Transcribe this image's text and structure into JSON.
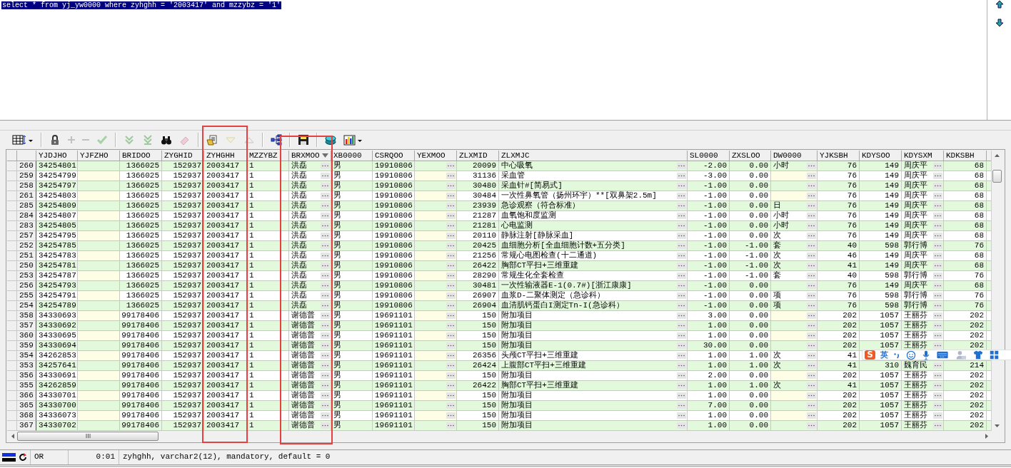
{
  "sql_editor": {
    "query": "select * from yj_yw0000 where zyhghh = '2003417' and mzzybz = '1'",
    "selected": true
  },
  "toolbar": [
    {
      "kind": "grid",
      "disabled": false
    },
    {
      "kind": "separator"
    },
    {
      "kind": "lock",
      "disabled": false
    },
    {
      "kind": "add",
      "disabled": true
    },
    {
      "kind": "remove",
      "disabled": true
    },
    {
      "kind": "confirm",
      "disabled": true
    },
    {
      "kind": "separator"
    },
    {
      "kind": "next",
      "disabled": true
    },
    {
      "kind": "last",
      "disabled": true
    },
    {
      "kind": "find",
      "disabled": false
    },
    {
      "kind": "clear",
      "disabled": true
    },
    {
      "kind": "separator"
    },
    {
      "kind": "query",
      "disabled": false
    },
    {
      "kind": "down",
      "disabled": true
    },
    {
      "kind": "up",
      "disabled": true
    },
    {
      "kind": "separator"
    },
    {
      "kind": "tree",
      "disabled": false
    },
    {
      "kind": "separator"
    },
    {
      "kind": "save",
      "disabled": false
    },
    {
      "kind": "separator"
    },
    {
      "kind": "database",
      "disabled": false
    },
    {
      "kind": "chart",
      "disabled": false
    }
  ],
  "table": {
    "columns": [
      {
        "kind": "rownum"
      },
      {
        "title": "YJDJHO",
        "kind": "text",
        "filter": false
      },
      {
        "title": "YJFZHO",
        "kind": "text",
        "filter": false
      },
      {
        "title": "BRIDOO",
        "kind": "number",
        "filter": false
      },
      {
        "title": "ZYGHID",
        "kind": "number",
        "filter": false
      },
      {
        "title": "ZYHGHH",
        "kind": "text",
        "filter": false
      },
      {
        "title": "MZZYBZ",
        "kind": "text",
        "filter": false
      },
      {
        "title": "BRXMOO",
        "kind": "lookup",
        "filter": true
      },
      {
        "title": "XB0000",
        "kind": "text",
        "filter": false
      },
      {
        "title": "CSRQOO",
        "kind": "text",
        "filter": false
      },
      {
        "title": "YEXMOO",
        "kind": "lookup",
        "filter": false
      },
      {
        "title": "ZLXMID",
        "kind": "number",
        "filter": false
      },
      {
        "title": "ZLXMJC",
        "kind": "lookup",
        "filter": false
      },
      {
        "title": "SL0000",
        "kind": "number",
        "filter": false
      },
      {
        "title": "ZXSLOO",
        "kind": "number",
        "filter": false
      },
      {
        "title": "DW0000",
        "kind": "lookup",
        "filter": false
      },
      {
        "title": "YJKSBH",
        "kind": "number",
        "filter": false
      },
      {
        "title": "KDYSOO",
        "kind": "number",
        "filter": false
      },
      {
        "title": "KDYSXM",
        "kind": "lookup",
        "filter": false
      },
      {
        "title": "KDKSBH",
        "kind": "number",
        "filter": false
      }
    ],
    "rows": [
      [
        "260",
        "34254801",
        null,
        "1366025",
        "152937",
        "2003417",
        "1",
        "洪磊",
        "男",
        "19910806",
        null,
        "20099",
        "中心吸氧",
        "-2.00",
        "0.00",
        "小时",
        "76",
        "149",
        "周庆平",
        "68"
      ],
      [
        "259",
        "34254799",
        null,
        "1366025",
        "152937",
        "2003417",
        "1",
        "洪磊",
        "男",
        "19910806",
        null,
        "31136",
        "采血管",
        "-3.00",
        "0.00",
        null,
        "76",
        "149",
        "周庆平",
        "68"
      ],
      [
        "258",
        "34254797",
        null,
        "1366025",
        "152937",
        "2003417",
        "1",
        "洪磊",
        "男",
        "19910806",
        null,
        "30480",
        "采血针#[简易式]",
        "-1.00",
        "0.00",
        null,
        "76",
        "149",
        "周庆平",
        "68"
      ],
      [
        "261",
        "34254803",
        null,
        "1366025",
        "152937",
        "2003417",
        "1",
        "洪磊",
        "男",
        "19910806",
        null,
        "30484",
        "一次性鼻氧管（扬州环宇）**[双鼻架2.5m]",
        "-1.00",
        "0.00",
        null,
        "76",
        "149",
        "周庆平",
        "68"
      ],
      [
        "285",
        "34254809",
        null,
        "1366025",
        "152937",
        "2003417",
        "1",
        "洪磊",
        "男",
        "19910806",
        null,
        "23939",
        "急诊观察（符合标准）",
        "-1.00",
        "0.00",
        "日",
        "76",
        "149",
        "周庆平",
        "68"
      ],
      [
        "284",
        "34254807",
        null,
        "1366025",
        "152937",
        "2003417",
        "1",
        "洪磊",
        "男",
        "19910806",
        null,
        "21287",
        "血氧饱和度监测",
        "-1.00",
        "0.00",
        "小时",
        "76",
        "149",
        "周庆平",
        "68"
      ],
      [
        "283",
        "34254805",
        null,
        "1366025",
        "152937",
        "2003417",
        "1",
        "洪磊",
        "男",
        "19910806",
        null,
        "21281",
        "心电监测",
        "-1.00",
        "0.00",
        "小时",
        "76",
        "149",
        "周庆平",
        "68"
      ],
      [
        "257",
        "34254795",
        null,
        "1366025",
        "152937",
        "2003417",
        "1",
        "洪磊",
        "男",
        "19910806",
        null,
        "20110",
        "静脉注射[静脉采血]",
        "-1.00",
        "0.00",
        "次",
        "76",
        "149",
        "周庆平",
        "68"
      ],
      [
        "252",
        "34254785",
        null,
        "1366025",
        "152937",
        "2003417",
        "1",
        "洪磊",
        "男",
        "19910806",
        null,
        "20425",
        "血细胞分析[全血细胞计数+五分类]",
        "-1.00",
        "-1.00",
        "套",
        "40",
        "598",
        "郭行博",
        "76"
      ],
      [
        "251",
        "34254783",
        null,
        "1366025",
        "152937",
        "2003417",
        "1",
        "洪磊",
        "男",
        "19910806",
        null,
        "21256",
        "常规心电图检查(十二通道)",
        "-1.00",
        "-1.00",
        "次",
        "46",
        "149",
        "周庆平",
        "68"
      ],
      [
        "250",
        "34254781",
        null,
        "1366025",
        "152937",
        "2003417",
        "1",
        "洪磊",
        "男",
        "19910806",
        null,
        "26422",
        "胸部CT平扫+三维重建",
        "-1.00",
        "-1.00",
        "次",
        "41",
        "149",
        "周庆平",
        "68"
      ],
      [
        "253",
        "34254787",
        null,
        "1366025",
        "152937",
        "2003417",
        "1",
        "洪磊",
        "男",
        "19910806",
        null,
        "28290",
        "常规生化全套检查",
        "-1.00",
        "-1.00",
        "套",
        "40",
        "598",
        "郭行博",
        "76"
      ],
      [
        "256",
        "34254793",
        null,
        "1366025",
        "152937",
        "2003417",
        "1",
        "洪磊",
        "男",
        "19910806",
        null,
        "30481",
        "一次性输液器E-1(0.7#)[浙江康康]",
        "-1.00",
        "0.00",
        null,
        "76",
        "149",
        "周庆平",
        "68"
      ],
      [
        "255",
        "34254791",
        null,
        "1366025",
        "152937",
        "2003417",
        "1",
        "洪磊",
        "男",
        "19910806",
        null,
        "26907",
        "血浆D-二聚体测定（急诊科）",
        "-1.00",
        "0.00",
        "项",
        "76",
        "598",
        "郭行博",
        "76"
      ],
      [
        "254",
        "34254789",
        null,
        "1366025",
        "152937",
        "2003417",
        "1",
        "洪磊",
        "男",
        "19910806",
        null,
        "26904",
        "血清肌钙蛋白I测定Tn-I(急诊科）",
        "-1.00",
        "0.00",
        "项",
        "76",
        "598",
        "郭行博",
        "76"
      ],
      [
        "358",
        "34330693",
        null,
        "99178406",
        "152937",
        "2003417",
        "1",
        "谢德普",
        "男",
        "19691101",
        null,
        "150",
        "附加项目",
        "3.00",
        "0.00",
        null,
        "202",
        "1057",
        "王丽芬",
        "202"
      ],
      [
        "357",
        "34330692",
        null,
        "99178406",
        "152937",
        "2003417",
        "1",
        "谢德普",
        "男",
        "19691101",
        null,
        "150",
        "附加项目",
        "1.00",
        "0.00",
        null,
        "202",
        "1057",
        "王丽芬",
        "202"
      ],
      [
        "360",
        "34330695",
        null,
        "99178406",
        "152937",
        "2003417",
        "1",
        "谢德普",
        "男",
        "19691101",
        null,
        "150",
        "附加项目",
        "1.00",
        "0.00",
        null,
        "202",
        "1057",
        "王丽芬",
        "202"
      ],
      [
        "359",
        "34330694",
        null,
        "99178406",
        "152937",
        "2003417",
        "1",
        "谢德普",
        "男",
        "19691101",
        null,
        "150",
        "附加项目",
        "30.00",
        "0.00",
        null,
        "202",
        "1057",
        "王丽芬",
        "202"
      ],
      [
        "354",
        "34262853",
        null,
        "99178406",
        "152937",
        "2003417",
        "1",
        "谢德普",
        "男",
        "19691101",
        null,
        "26356",
        "头颅CT平扫+三维重建",
        "1.00",
        "1.00",
        "次",
        "41"
      ],
      [
        "353",
        "34257641",
        null,
        "99178406",
        "152937",
        "2003417",
        "1",
        "谢德普",
        "男",
        "19691101",
        null,
        "26424",
        "上腹部CT平扫+三维重建",
        "1.00",
        "1.00",
        "次",
        "41",
        "310",
        "魏育民",
        "214"
      ],
      [
        "356",
        "34330691",
        null,
        "99178406",
        "152937",
        "2003417",
        "1",
        "谢德普",
        "男",
        "19691101",
        null,
        "150",
        "附加项目",
        "2.00",
        "0.00",
        null,
        "202",
        "1057",
        "王丽芬",
        "202"
      ],
      [
        "355",
        "34262859",
        null,
        "99178406",
        "152937",
        "2003417",
        "1",
        "谢德普",
        "男",
        "19691101",
        null,
        "26422",
        "胸部CT平扫+三维重建",
        "1.00",
        "1.00",
        "次",
        "41",
        "1057",
        "王丽芬",
        "202"
      ],
      [
        "366",
        "34330701",
        null,
        "99178406",
        "152937",
        "2003417",
        "1",
        "谢德普",
        "男",
        "19691101",
        null,
        "150",
        "附加项目",
        "1.00",
        "0.00",
        null,
        "202",
        "1057",
        "王丽芬",
        "202"
      ],
      [
        "365",
        "34330700",
        null,
        "99178406",
        "152937",
        "2003417",
        "1",
        "谢德普",
        "男",
        "19691101",
        null,
        "150",
        "附加项目",
        "7.00",
        "0.00",
        null,
        "202",
        "1057",
        "王丽芬",
        "202"
      ],
      [
        "368",
        "34336073",
        null,
        "99178406",
        "152937",
        "2003417",
        "1",
        "谢德普",
        "男",
        "19691101",
        null,
        "150",
        "附加项目",
        "1.00",
        "0.00",
        null,
        "202",
        "1057",
        "王丽芬",
        "202"
      ],
      [
        "367",
        "34330702",
        null,
        "99178406",
        "152937",
        "2003417",
        "1",
        "谢德普",
        "男",
        "19691101",
        null,
        "150",
        "附加项目",
        "1.00",
        "0.00",
        null,
        "202",
        "1057",
        "王丽芬",
        "202"
      ]
    ]
  },
  "status_bar": {
    "mode": "OR",
    "elapsed": "0:01",
    "message": "zyhghh, varchar2(12), mandatory, default = 0"
  },
  "ime_toolbar": {
    "logo": "S",
    "mode": "英"
  }
}
